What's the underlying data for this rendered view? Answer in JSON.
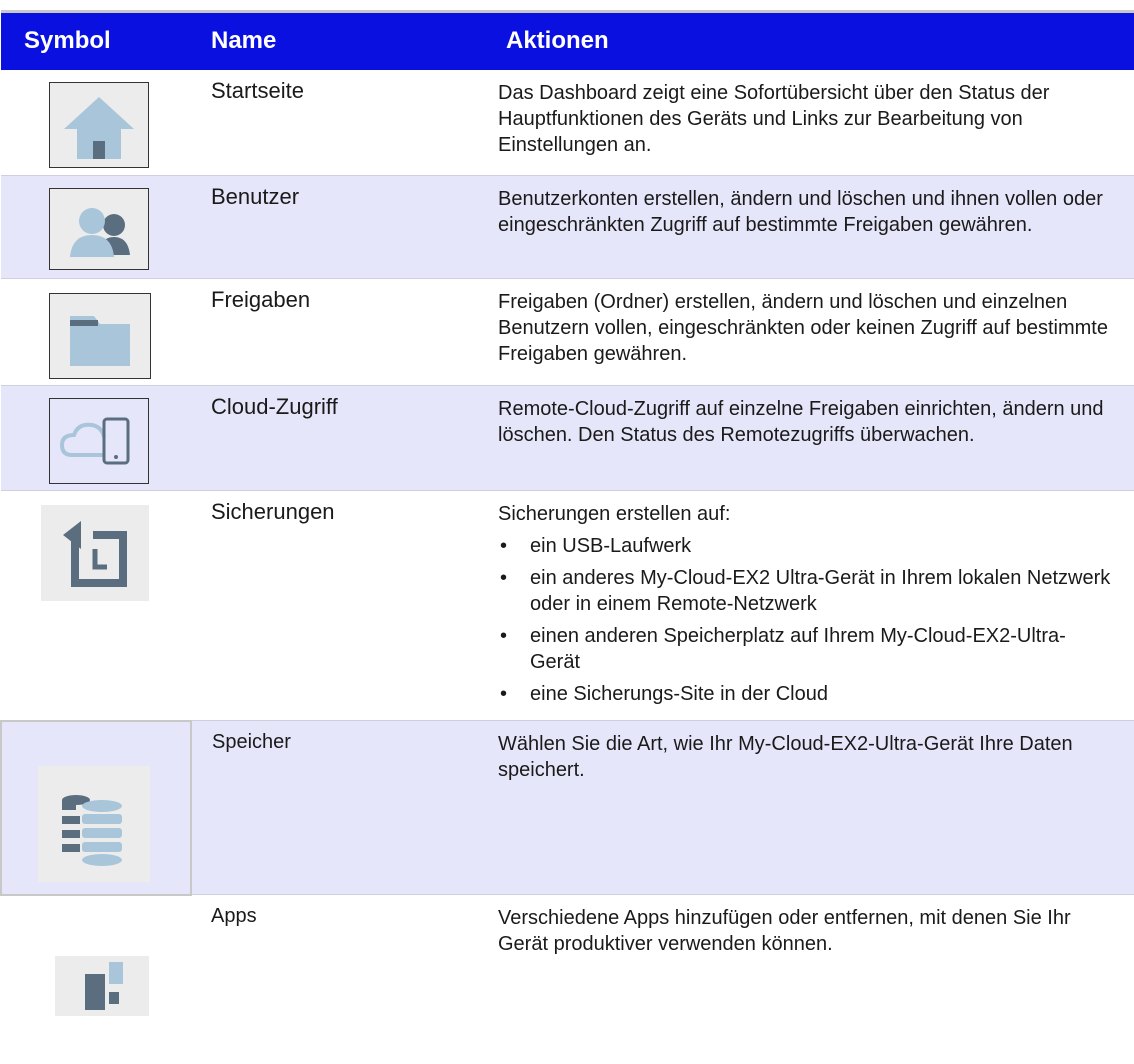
{
  "header": {
    "symbol": "Symbol",
    "name": "Name",
    "actions": "Aktionen"
  },
  "colors": {
    "header_bg": "#0a10e0",
    "row_shade": "#e6e6fa",
    "icon_fill": "#a9c5da",
    "icon_dark": "#5a6e80"
  },
  "rows": [
    {
      "icon": "home-icon",
      "name": "Startseite",
      "description": "Das Dashboard zeigt eine Sofortübersicht über den Status der Hauptfunktionen des Geräts und Links zur Bearbeitung von Einstellungen an."
    },
    {
      "icon": "users-icon",
      "name": "Benutzer",
      "description": "Benutzerkonten erstellen, ändern und löschen und ihnen vollen oder eingeschränkten Zugriff auf bestimmte Freigaben gewähren."
    },
    {
      "icon": "folder-icon",
      "name": "Freigaben",
      "description": "Freigaben (Ordner) erstellen, ändern und löschen und einzelnen Benutzern vollen, eingeschränkten oder keinen Zugriff auf bestimmte Freigaben gewähren."
    },
    {
      "icon": "cloud-device-icon",
      "name": "Cloud-Zugriff",
      "description": "Remote-Cloud-Zugriff auf einzelne Freigaben einrichten, ändern und löschen. Den Status des Remotezugriffs überwachen."
    },
    {
      "icon": "backup-clock-icon",
      "name": "Sicherungen",
      "description": "Sicherungen erstellen auf:",
      "bullets": [
        "ein USB-Laufwerk",
        "ein anderes My-Cloud-EX2 Ultra-Gerät in Ihrem lokalen Netzwerk oder in einem Remote-Netzwerk",
        "einen anderen Speicherplatz auf Ihrem My-Cloud-EX2-Ultra-Gerät",
        "eine Sicherungs-Site in der Cloud"
      ]
    },
    {
      "icon": "storage-stack-icon",
      "name": "Speicher",
      "description": "Wählen Sie die Art, wie Ihr My-Cloud-EX2-Ultra-Gerät Ihre Daten speichert."
    },
    {
      "icon": "apps-icon",
      "name": "Apps",
      "description": "Verschiedene Apps hinzufügen oder entfernen, mit denen Sie Ihr Gerät produktiver verwenden können."
    }
  ]
}
